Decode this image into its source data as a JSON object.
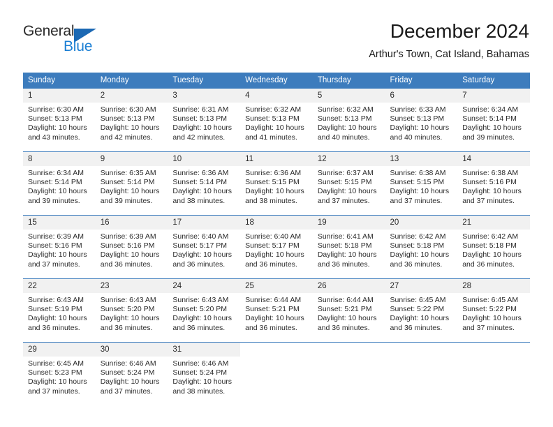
{
  "logo": {
    "word_top": "General",
    "word_bottom": "Blue",
    "triangle_icon": "blue-triangle-icon",
    "accent_dark": "#1b68b3",
    "accent_light": "#1b7fd4"
  },
  "header": {
    "title": "December 2024",
    "subtitle": "Arthur's Town, Cat Island, Bahamas"
  },
  "theme": {
    "header_blue": "#3d7cbd",
    "daynum_bg": "#f1f1f1",
    "text": "#2b2b2b"
  },
  "weekdays": [
    "Sunday",
    "Monday",
    "Tuesday",
    "Wednesday",
    "Thursday",
    "Friday",
    "Saturday"
  ],
  "weeks": [
    {
      "days": [
        {
          "num": "1",
          "sunrise": "Sunrise: 6:30 AM",
          "sunset": "Sunset: 5:13 PM",
          "daylight1": "Daylight: 10 hours",
          "daylight2": "and 43 minutes."
        },
        {
          "num": "2",
          "sunrise": "Sunrise: 6:30 AM",
          "sunset": "Sunset: 5:13 PM",
          "daylight1": "Daylight: 10 hours",
          "daylight2": "and 42 minutes."
        },
        {
          "num": "3",
          "sunrise": "Sunrise: 6:31 AM",
          "sunset": "Sunset: 5:13 PM",
          "daylight1": "Daylight: 10 hours",
          "daylight2": "and 42 minutes."
        },
        {
          "num": "4",
          "sunrise": "Sunrise: 6:32 AM",
          "sunset": "Sunset: 5:13 PM",
          "daylight1": "Daylight: 10 hours",
          "daylight2": "and 41 minutes."
        },
        {
          "num": "5",
          "sunrise": "Sunrise: 6:32 AM",
          "sunset": "Sunset: 5:13 PM",
          "daylight1": "Daylight: 10 hours",
          "daylight2": "and 40 minutes."
        },
        {
          "num": "6",
          "sunrise": "Sunrise: 6:33 AM",
          "sunset": "Sunset: 5:13 PM",
          "daylight1": "Daylight: 10 hours",
          "daylight2": "and 40 minutes."
        },
        {
          "num": "7",
          "sunrise": "Sunrise: 6:34 AM",
          "sunset": "Sunset: 5:14 PM",
          "daylight1": "Daylight: 10 hours",
          "daylight2": "and 39 minutes."
        }
      ]
    },
    {
      "days": [
        {
          "num": "8",
          "sunrise": "Sunrise: 6:34 AM",
          "sunset": "Sunset: 5:14 PM",
          "daylight1": "Daylight: 10 hours",
          "daylight2": "and 39 minutes."
        },
        {
          "num": "9",
          "sunrise": "Sunrise: 6:35 AM",
          "sunset": "Sunset: 5:14 PM",
          "daylight1": "Daylight: 10 hours",
          "daylight2": "and 39 minutes."
        },
        {
          "num": "10",
          "sunrise": "Sunrise: 6:36 AM",
          "sunset": "Sunset: 5:14 PM",
          "daylight1": "Daylight: 10 hours",
          "daylight2": "and 38 minutes."
        },
        {
          "num": "11",
          "sunrise": "Sunrise: 6:36 AM",
          "sunset": "Sunset: 5:15 PM",
          "daylight1": "Daylight: 10 hours",
          "daylight2": "and 38 minutes."
        },
        {
          "num": "12",
          "sunrise": "Sunrise: 6:37 AM",
          "sunset": "Sunset: 5:15 PM",
          "daylight1": "Daylight: 10 hours",
          "daylight2": "and 37 minutes."
        },
        {
          "num": "13",
          "sunrise": "Sunrise: 6:38 AM",
          "sunset": "Sunset: 5:15 PM",
          "daylight1": "Daylight: 10 hours",
          "daylight2": "and 37 minutes."
        },
        {
          "num": "14",
          "sunrise": "Sunrise: 6:38 AM",
          "sunset": "Sunset: 5:16 PM",
          "daylight1": "Daylight: 10 hours",
          "daylight2": "and 37 minutes."
        }
      ]
    },
    {
      "days": [
        {
          "num": "15",
          "sunrise": "Sunrise: 6:39 AM",
          "sunset": "Sunset: 5:16 PM",
          "daylight1": "Daylight: 10 hours",
          "daylight2": "and 37 minutes."
        },
        {
          "num": "16",
          "sunrise": "Sunrise: 6:39 AM",
          "sunset": "Sunset: 5:16 PM",
          "daylight1": "Daylight: 10 hours",
          "daylight2": "and 36 minutes."
        },
        {
          "num": "17",
          "sunrise": "Sunrise: 6:40 AM",
          "sunset": "Sunset: 5:17 PM",
          "daylight1": "Daylight: 10 hours",
          "daylight2": "and 36 minutes."
        },
        {
          "num": "18",
          "sunrise": "Sunrise: 6:40 AM",
          "sunset": "Sunset: 5:17 PM",
          "daylight1": "Daylight: 10 hours",
          "daylight2": "and 36 minutes."
        },
        {
          "num": "19",
          "sunrise": "Sunrise: 6:41 AM",
          "sunset": "Sunset: 5:18 PM",
          "daylight1": "Daylight: 10 hours",
          "daylight2": "and 36 minutes."
        },
        {
          "num": "20",
          "sunrise": "Sunrise: 6:42 AM",
          "sunset": "Sunset: 5:18 PM",
          "daylight1": "Daylight: 10 hours",
          "daylight2": "and 36 minutes."
        },
        {
          "num": "21",
          "sunrise": "Sunrise: 6:42 AM",
          "sunset": "Sunset: 5:18 PM",
          "daylight1": "Daylight: 10 hours",
          "daylight2": "and 36 minutes."
        }
      ]
    },
    {
      "days": [
        {
          "num": "22",
          "sunrise": "Sunrise: 6:43 AM",
          "sunset": "Sunset: 5:19 PM",
          "daylight1": "Daylight: 10 hours",
          "daylight2": "and 36 minutes."
        },
        {
          "num": "23",
          "sunrise": "Sunrise: 6:43 AM",
          "sunset": "Sunset: 5:20 PM",
          "daylight1": "Daylight: 10 hours",
          "daylight2": "and 36 minutes."
        },
        {
          "num": "24",
          "sunrise": "Sunrise: 6:43 AM",
          "sunset": "Sunset: 5:20 PM",
          "daylight1": "Daylight: 10 hours",
          "daylight2": "and 36 minutes."
        },
        {
          "num": "25",
          "sunrise": "Sunrise: 6:44 AM",
          "sunset": "Sunset: 5:21 PM",
          "daylight1": "Daylight: 10 hours",
          "daylight2": "and 36 minutes."
        },
        {
          "num": "26",
          "sunrise": "Sunrise: 6:44 AM",
          "sunset": "Sunset: 5:21 PM",
          "daylight1": "Daylight: 10 hours",
          "daylight2": "and 36 minutes."
        },
        {
          "num": "27",
          "sunrise": "Sunrise: 6:45 AM",
          "sunset": "Sunset: 5:22 PM",
          "daylight1": "Daylight: 10 hours",
          "daylight2": "and 36 minutes."
        },
        {
          "num": "28",
          "sunrise": "Sunrise: 6:45 AM",
          "sunset": "Sunset: 5:22 PM",
          "daylight1": "Daylight: 10 hours",
          "daylight2": "and 37 minutes."
        }
      ]
    },
    {
      "days": [
        {
          "num": "29",
          "sunrise": "Sunrise: 6:45 AM",
          "sunset": "Sunset: 5:23 PM",
          "daylight1": "Daylight: 10 hours",
          "daylight2": "and 37 minutes."
        },
        {
          "num": "30",
          "sunrise": "Sunrise: 6:46 AM",
          "sunset": "Sunset: 5:24 PM",
          "daylight1": "Daylight: 10 hours",
          "daylight2": "and 37 minutes."
        },
        {
          "num": "31",
          "sunrise": "Sunrise: 6:46 AM",
          "sunset": "Sunset: 5:24 PM",
          "daylight1": "Daylight: 10 hours",
          "daylight2": "and 38 minutes."
        },
        {
          "num": "",
          "sunrise": "",
          "sunset": "",
          "daylight1": "",
          "daylight2": ""
        },
        {
          "num": "",
          "sunrise": "",
          "sunset": "",
          "daylight1": "",
          "daylight2": ""
        },
        {
          "num": "",
          "sunrise": "",
          "sunset": "",
          "daylight1": "",
          "daylight2": ""
        },
        {
          "num": "",
          "sunrise": "",
          "sunset": "",
          "daylight1": "",
          "daylight2": ""
        }
      ]
    }
  ]
}
